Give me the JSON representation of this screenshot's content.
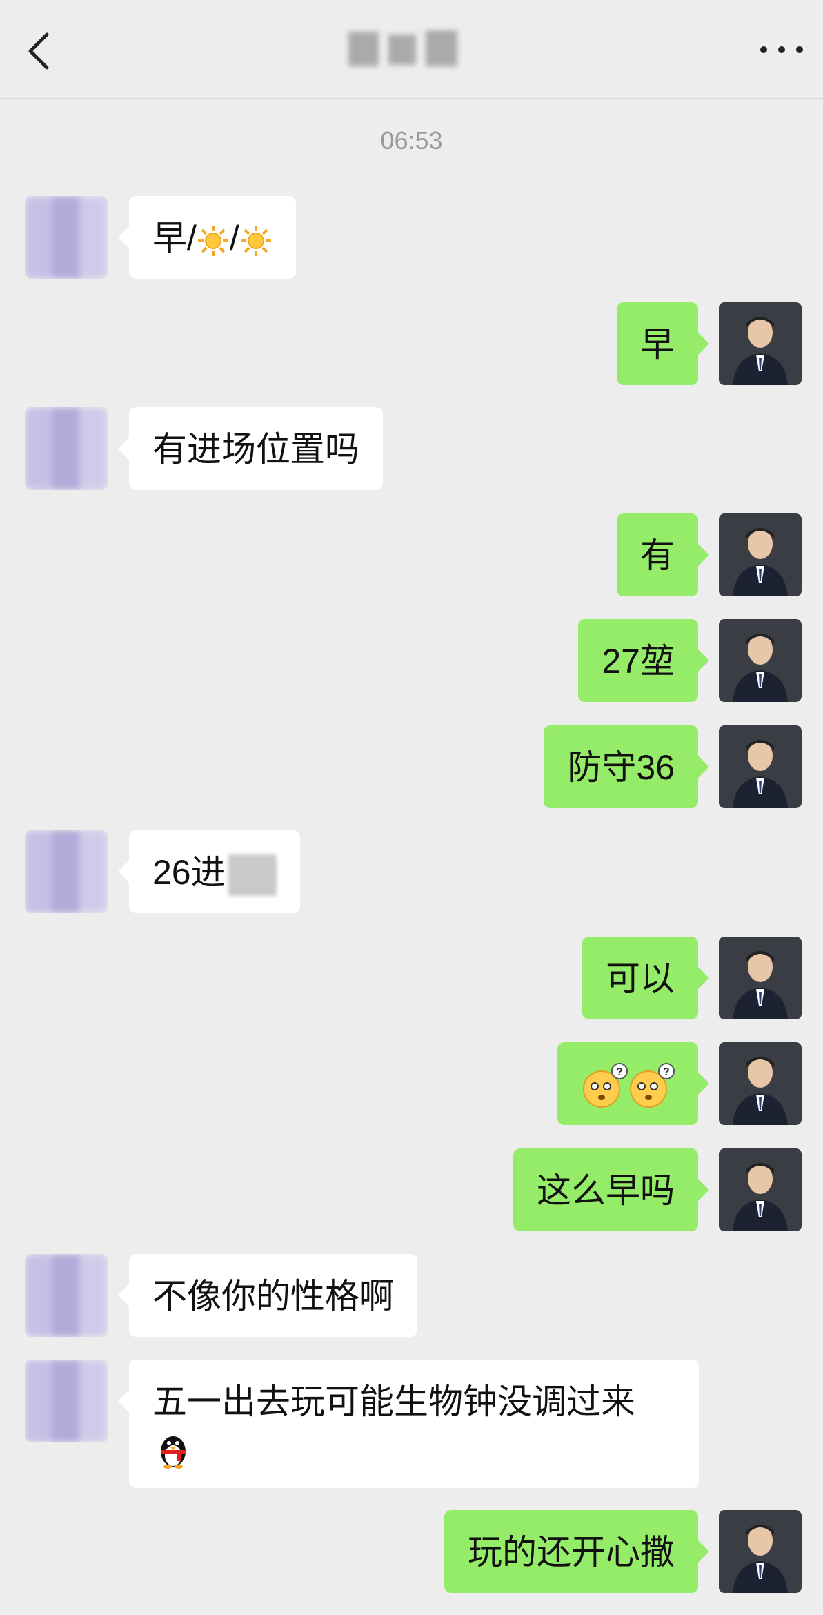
{
  "header": {
    "more_label": "···"
  },
  "timestamp": "06:53",
  "messages": [
    {
      "side": "in",
      "text": "早/",
      "extra": "☀/☀"
    },
    {
      "side": "out",
      "text": "早"
    },
    {
      "side": "in",
      "text": "有进场位置吗"
    },
    {
      "side": "out",
      "text": "有"
    },
    {
      "side": "out",
      "text": "27堃"
    },
    {
      "side": "out",
      "text": "防守36"
    },
    {
      "side": "in",
      "text": "26进"
    },
    {
      "side": "out",
      "text": "可以"
    },
    {
      "side": "out",
      "text": "[emoji] [emoji]"
    },
    {
      "side": "out",
      "text": "这么早吗"
    },
    {
      "side": "in",
      "text": "不像你的性格啊"
    },
    {
      "side": "in",
      "text": "五一出去玩可能生物钟没调过来"
    },
    {
      "side": "out",
      "text": "玩的还开心撒"
    }
  ],
  "colors": {
    "background": "#ededed",
    "outgoing_bubble": "#95ec69",
    "incoming_bubble": "#ffffff",
    "timestamp": "#9a9a9a"
  },
  "icons": [
    "chevron-left-icon",
    "more-icon",
    "sun-emoji-icon",
    "thinking-emoji-icon",
    "penguin-emoji-icon"
  ]
}
